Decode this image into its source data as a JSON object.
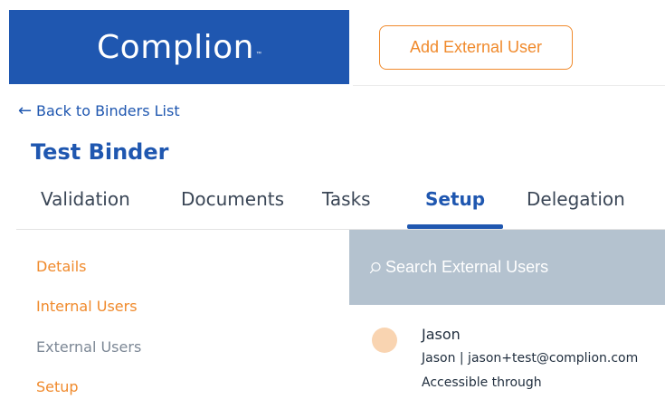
{
  "header": {
    "logo_text": "Complion",
    "logo_tm": "™",
    "add_button_label": "Add External User"
  },
  "nav": {
    "back_label": "Back to Binders List",
    "back_icon": "arrow-left-icon"
  },
  "page": {
    "title": "Test Binder"
  },
  "tabs": [
    {
      "label": "Validation",
      "active": false
    },
    {
      "label": "Documents",
      "active": false
    },
    {
      "label": "Tasks",
      "active": false
    },
    {
      "label": "Setup",
      "active": true
    },
    {
      "label": "Delegation",
      "active": false
    }
  ],
  "sidebar": {
    "items": [
      {
        "label": "Details",
        "state": "link"
      },
      {
        "label": "Internal Users",
        "state": "link"
      },
      {
        "label": "External Users",
        "state": "current"
      },
      {
        "label": "Setup",
        "state": "link"
      }
    ]
  },
  "search": {
    "placeholder": "Search External Users",
    "icon": "search-icon"
  },
  "user": {
    "name": "Jason",
    "subline": "Jason | jason+test@complion.com",
    "access": "Accessible through"
  },
  "colors": {
    "brand_blue": "#1f57b0",
    "accent_orange": "#f08a2c",
    "search_bg": "#b4c2cf",
    "muted_text": "#7d8896",
    "avatar": "#f9d4b1"
  }
}
